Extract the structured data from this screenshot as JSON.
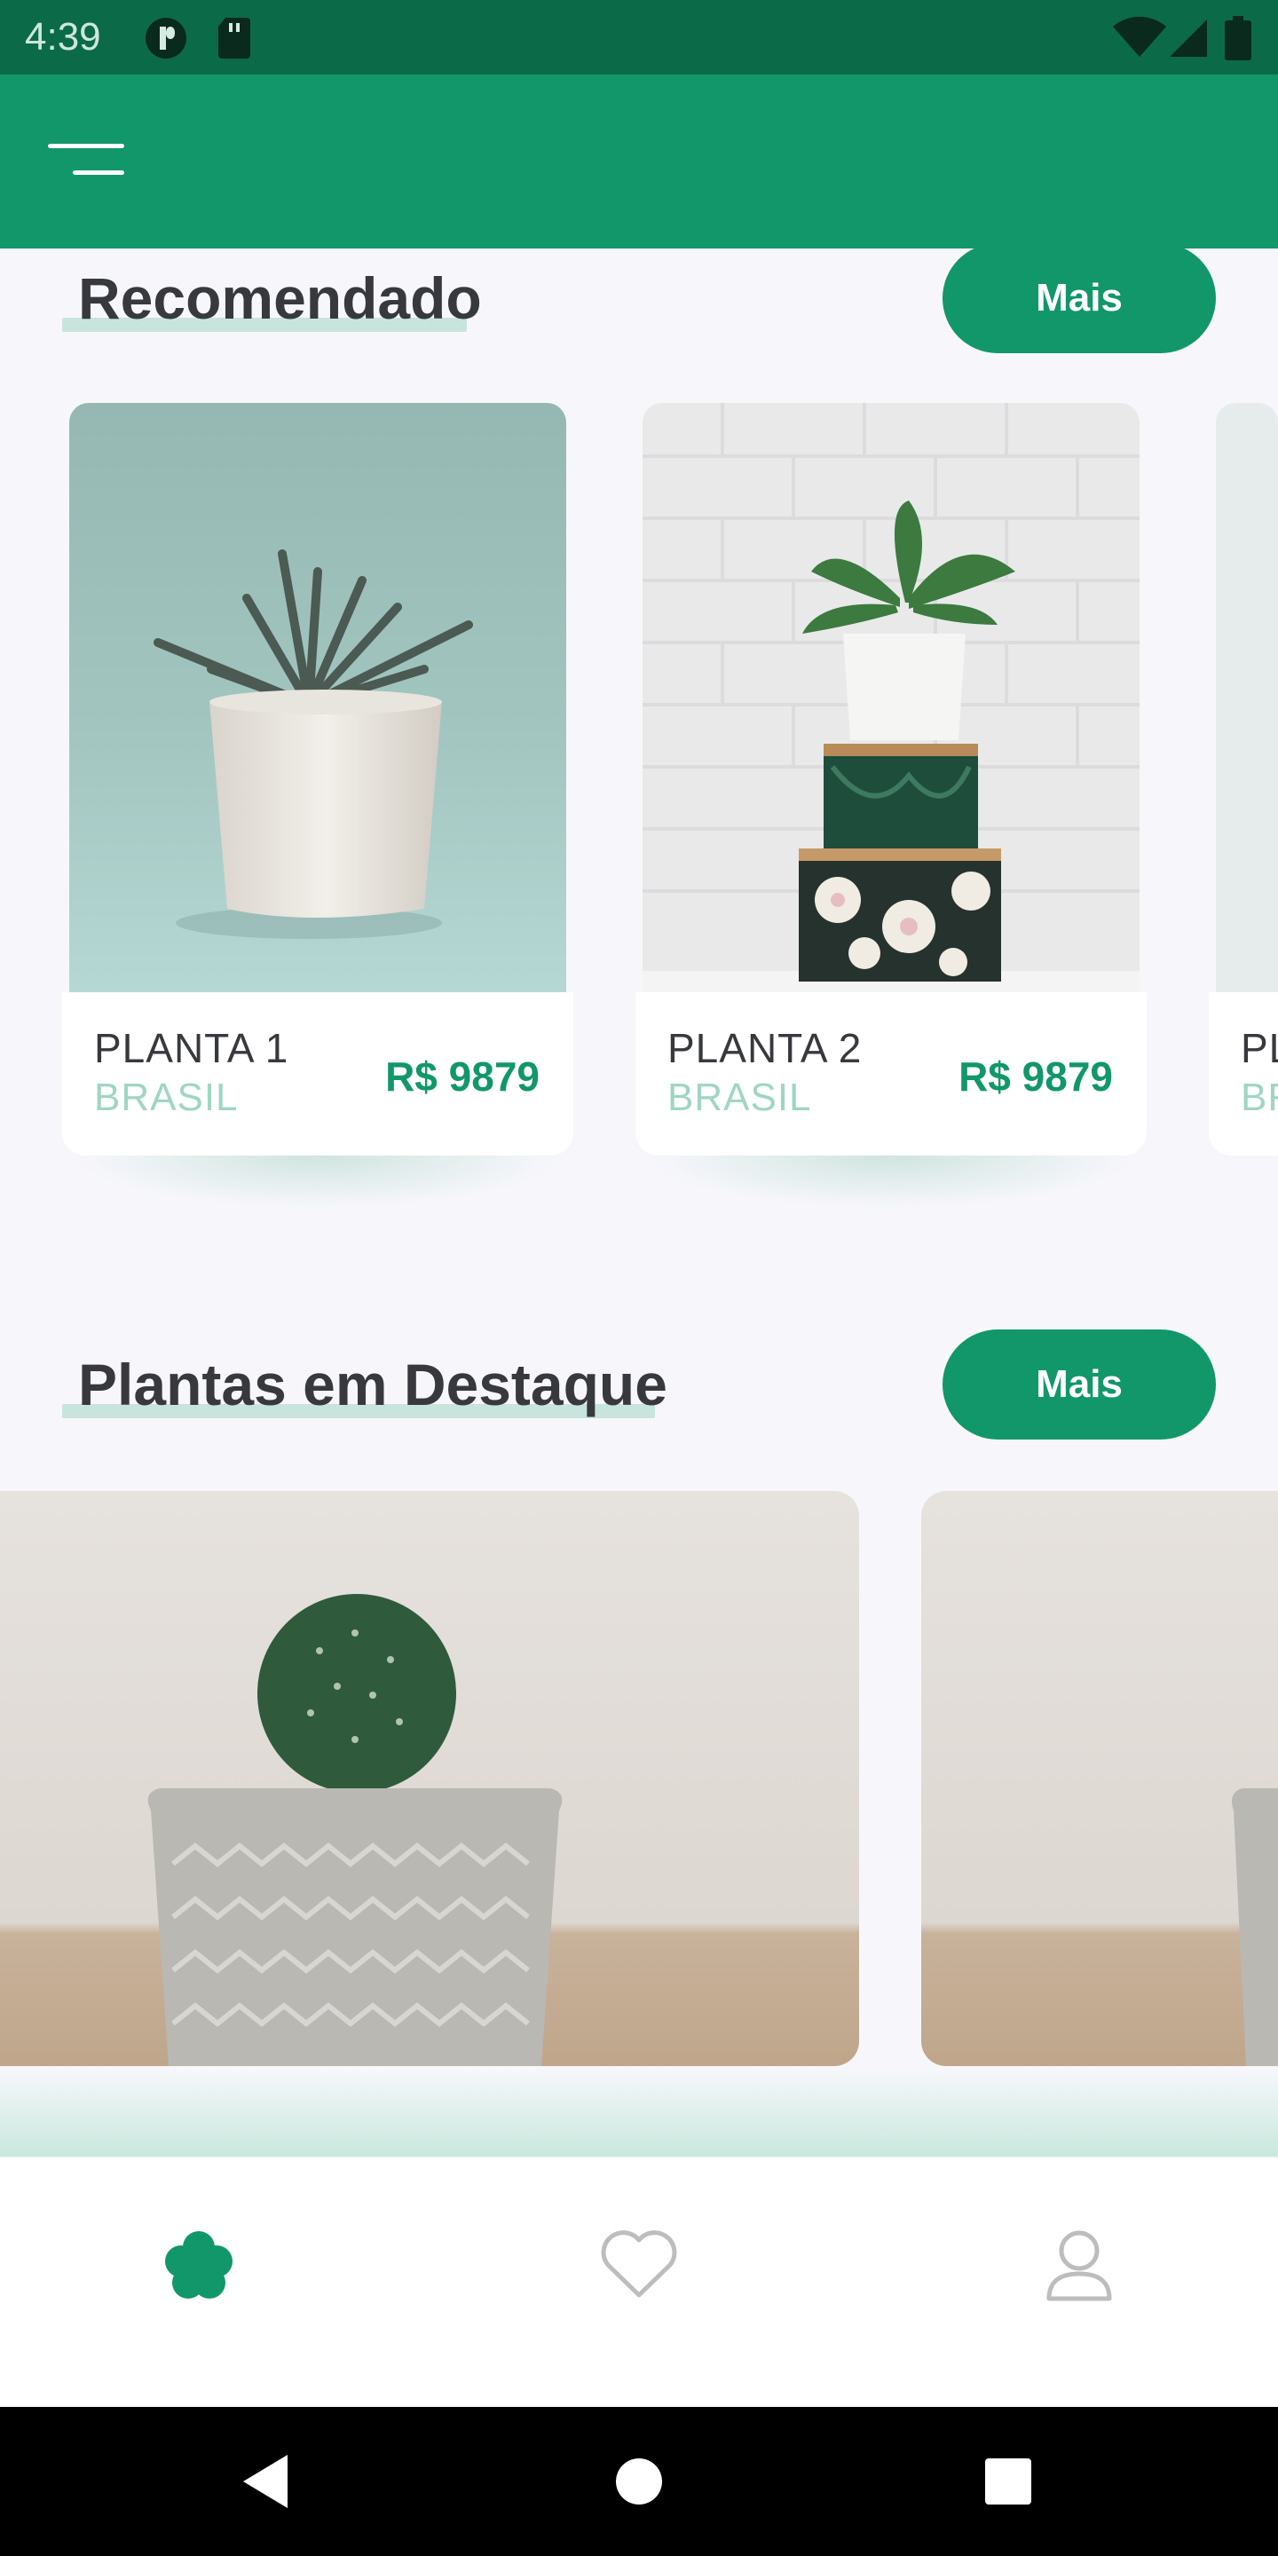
{
  "status_bar": {
    "time": "4:39",
    "icons": [
      "notification-icon",
      "sd-card-icon",
      "wifi-icon",
      "cell-signal-icon",
      "battery-icon"
    ]
  },
  "app_bar": {
    "menu_icon": "menu-icon",
    "color": "#11976a"
  },
  "recommended": {
    "title": "Recomendado",
    "more_label": "Mais",
    "items": [
      {
        "name": "PLANTA 1",
        "country": "BRASIL",
        "price": "R$ 9879"
      },
      {
        "name": "PLANTA 2",
        "country": "BRASIL",
        "price": "R$ 9879"
      },
      {
        "name": "PL",
        "country": "BR"
      }
    ]
  },
  "featured": {
    "title": "Plantas em Destaque",
    "more_label": "Mais"
  },
  "bottom_nav": {
    "items": [
      {
        "icon": "flower-icon",
        "active": true
      },
      {
        "icon": "heart-icon",
        "active": false
      },
      {
        "icon": "user-icon",
        "active": false
      }
    ]
  },
  "system_nav": {
    "icons": [
      "back-icon",
      "home-icon",
      "recents-icon"
    ]
  },
  "colors": {
    "primary": "#11976a",
    "status_bar": "#0b6b49",
    "accent_light": "#9fd6c2",
    "text_dark": "#37393f"
  }
}
